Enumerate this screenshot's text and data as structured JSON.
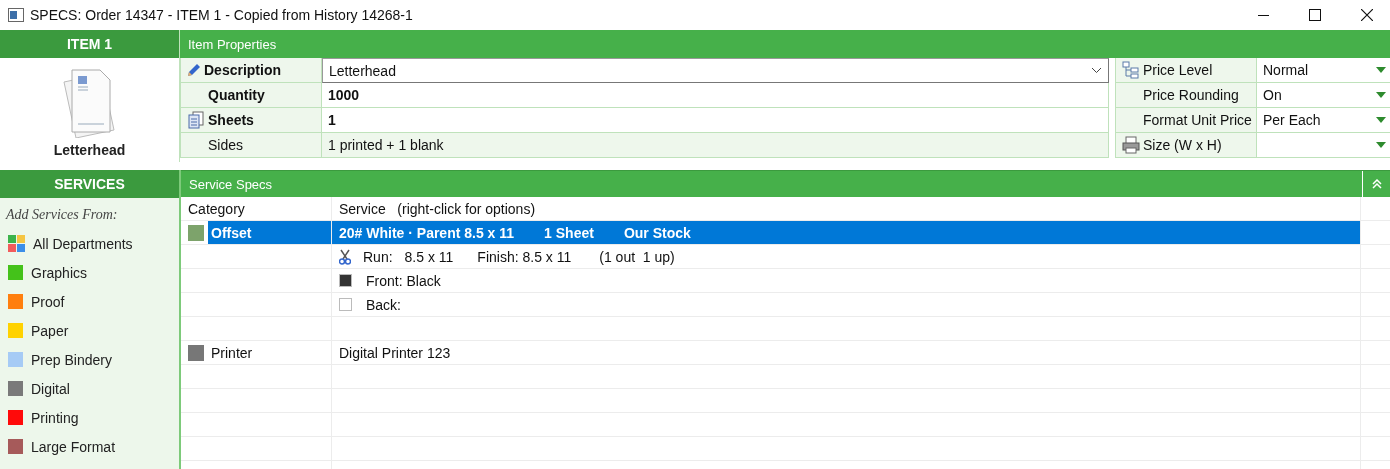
{
  "window": {
    "title": "SPECS: Order 14347 - ITEM 1 - Copied from History 14268-1"
  },
  "item": {
    "header": "ITEM 1",
    "name": "Letterhead"
  },
  "item_properties": {
    "title": "Item Properties",
    "rows": [
      {
        "label": "Description",
        "value": "Letterhead",
        "kind": "combo",
        "bold": true
      },
      {
        "label": "Quantity",
        "value": "1000",
        "kind": "text",
        "bold": true
      },
      {
        "label": "Sheets",
        "value": "1",
        "kind": "text",
        "bold": true
      },
      {
        "label": "Sides",
        "value": "1 printed + 1 blank",
        "kind": "static",
        "bold": false
      }
    ],
    "pricing": [
      {
        "label": "Price Level",
        "value": "Normal"
      },
      {
        "label": "Price Rounding",
        "value": "On"
      },
      {
        "label": "Format Unit Price",
        "value": "Per Each"
      },
      {
        "label": "Size (W x H)"
      }
    ]
  },
  "services": {
    "header": "SERVICES",
    "add_from": "Add Services From:",
    "departments": [
      {
        "kind": "all",
        "label": "All Departments"
      },
      {
        "kind": "color",
        "label": "Graphics",
        "color": "#44c21a"
      },
      {
        "kind": "color",
        "label": "Proof",
        "color": "#ff7f0e"
      },
      {
        "kind": "color",
        "label": "Paper",
        "color": "#ffd200"
      },
      {
        "kind": "color",
        "label": "Prep Bindery",
        "color": "#a6cbf5"
      },
      {
        "kind": "color",
        "label": "Digital",
        "color": "#7a7a7a"
      },
      {
        "kind": "color",
        "label": "Printing",
        "color": "#ff0a0a"
      },
      {
        "kind": "color",
        "label": "Large Format",
        "color": "#a65a5a"
      }
    ]
  },
  "service_specs": {
    "title": "Service Specs",
    "columns": [
      "Category",
      "Service   (right-click for options)"
    ],
    "rows": [
      {
        "kind": "category",
        "color": "#7da36b",
        "category": "Offset",
        "service": [
          "20# White · Parent 8.5 x 11",
          "1 Sheet",
          "Our Stock"
        ],
        "selected": true
      },
      {
        "kind": "run",
        "parts": [
          "Run:",
          "8.5 x 11",
          "Finish: 8.5 x 11",
          "(1 out  1 up)"
        ]
      },
      {
        "kind": "ink",
        "color": "#333333",
        "text": "Front: Black"
      },
      {
        "kind": "ink",
        "color": "#ffffff",
        "text": "Back:"
      },
      {
        "kind": "empty"
      },
      {
        "kind": "category",
        "color": "#777777",
        "category": "Printer",
        "service": [
          "Digital Printer 123"
        ],
        "selected": false
      }
    ]
  }
}
